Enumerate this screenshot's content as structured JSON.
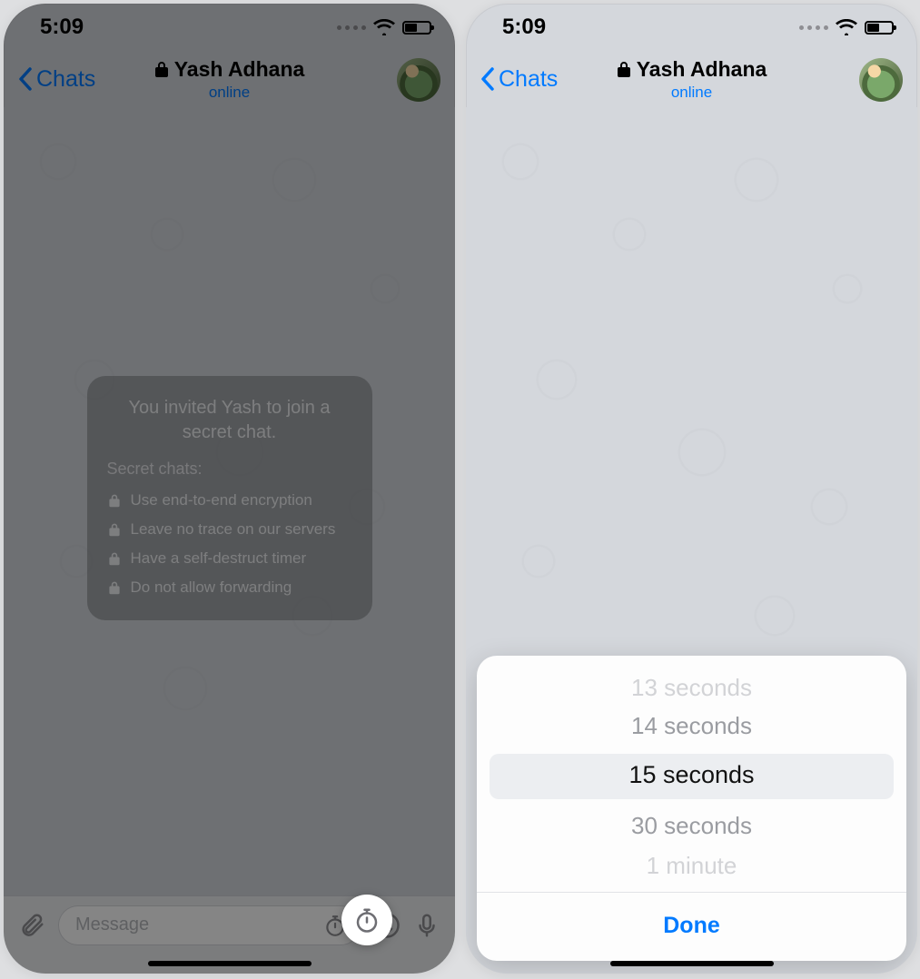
{
  "status": {
    "time": "5:09"
  },
  "header": {
    "back_label": "Chats",
    "contact_name": "Yash Adhana",
    "status_text": "online"
  },
  "secret_chat_info": {
    "headline": "You invited Yash to join a secret chat.",
    "section_title": "Secret chats:",
    "bullets": [
      "Use end-to-end encryption",
      "Leave no trace on our servers",
      "Have a self-destruct timer",
      "Do not allow forwarding"
    ]
  },
  "input": {
    "placeholder": "Message"
  },
  "timer_picker": {
    "options": [
      "13 seconds",
      "14 seconds",
      "15 seconds",
      "30 seconds",
      "1 minute"
    ],
    "selected_index": 2,
    "done_label": "Done"
  },
  "colors": {
    "accent": "#007aff"
  }
}
